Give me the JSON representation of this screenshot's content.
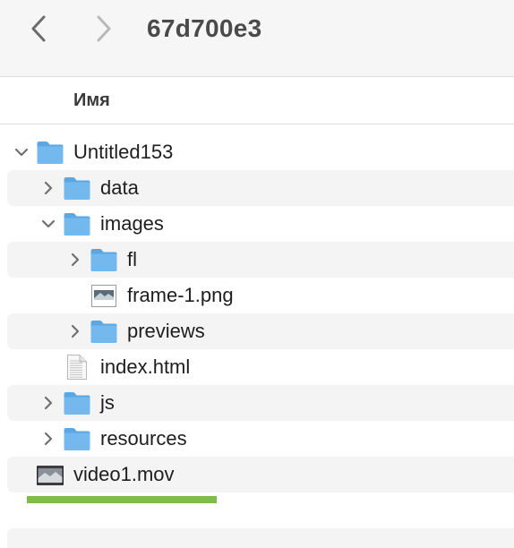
{
  "window": {
    "title": "67d700e3"
  },
  "toolbar": {
    "back_icon": "chevron-left-icon",
    "forward_icon": "chevron-right-icon"
  },
  "header": {
    "column_name": "Имя"
  },
  "tree": [
    {
      "name": "Untitled153",
      "kind": "folder",
      "level": 0,
      "disclosure": "expanded",
      "striped": false
    },
    {
      "name": "data",
      "kind": "folder",
      "level": 1,
      "disclosure": "collapsed",
      "striped": true
    },
    {
      "name": "images",
      "kind": "folder",
      "level": 1,
      "disclosure": "expanded",
      "striped": false
    },
    {
      "name": "fl",
      "kind": "folder",
      "level": 2,
      "disclosure": "collapsed",
      "striped": true
    },
    {
      "name": "frame-1.png",
      "kind": "image",
      "level": 2,
      "disclosure": "none",
      "striped": false
    },
    {
      "name": "previews",
      "kind": "folder",
      "level": 2,
      "disclosure": "collapsed",
      "striped": true
    },
    {
      "name": "index.html",
      "kind": "document",
      "level": 1,
      "disclosure": "none",
      "striped": false
    },
    {
      "name": "js",
      "kind": "folder",
      "level": 1,
      "disclosure": "collapsed",
      "striped": true
    },
    {
      "name": "resources",
      "kind": "folder",
      "level": 1,
      "disclosure": "collapsed",
      "striped": false
    },
    {
      "name": "video1.mov",
      "kind": "movie",
      "level": 0,
      "disclosure": "none",
      "striped": true
    }
  ],
  "copy_progress": {
    "fraction": 1.0,
    "color": "#7cbd4c"
  },
  "colors": {
    "folder_front": "#74b9ee",
    "folder_back": "#5aa7e4",
    "row_stripe": "#f4f4f4"
  }
}
